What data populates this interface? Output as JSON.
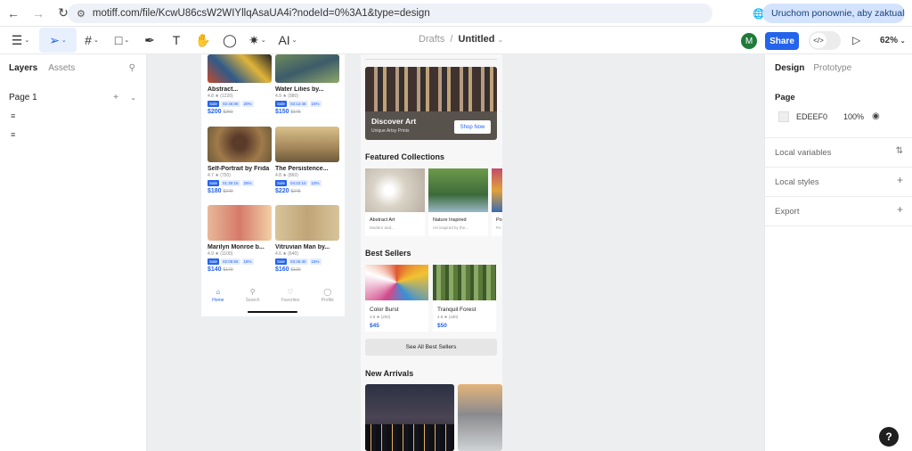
{
  "browser": {
    "url": "motiff.com/file/KcwU86csW2WIYllqAsaUA4i?nodeId=0%3A1&type=design",
    "profile_initial": "M",
    "restart_label": "Uruchom ponownie, aby zaktualizować"
  },
  "toolbar": {
    "ai_label": "AI",
    "breadcrumb_folder": "Drafts",
    "breadcrumb_sep": "/",
    "file_name": "Untitled",
    "user_initial": "M",
    "share_label": "Share",
    "zoom": "62%"
  },
  "left_panel": {
    "tab_layers": "Layers",
    "tab_assets": "Assets",
    "page_name": "Page 1"
  },
  "frame1": {
    "products": [
      {
        "title": "Abstract...",
        "rating": "4.8 ★ (1220)",
        "sale": "Sale",
        "timer": "02:46:06",
        "off": "20%",
        "price": "$200",
        "old": "$250",
        "color": "#b8503a"
      },
      {
        "title": "Water Lilies by...",
        "rating": "4.9 ★ (980)",
        "sale": "Sale",
        "timer": "03:12:46",
        "off": "15%",
        "price": "$150",
        "old": "$175",
        "color": "#4f6e4a"
      },
      {
        "title": "Self-Portrait by Frida",
        "rating": "4.7 ★ (750)",
        "sale": "Sale",
        "timer": "01:30:15",
        "off": "25%",
        "price": "$180",
        "old": "$240",
        "color": "#8a6a45"
      },
      {
        "title": "The Persistence...",
        "rating": "4.8 ★ (860)",
        "sale": "Sale",
        "timer": "04:22:10",
        "off": "10%",
        "price": "$220",
        "old": "$245",
        "color": "#b79a6a"
      },
      {
        "title": "Marilyn Monroe b...",
        "rating": "4.9 ★ (1100)",
        "sale": "Sale",
        "timer": "02:05:55",
        "off": "18%",
        "price": "$140",
        "old": "$170",
        "color": "#d9a088"
      },
      {
        "title": "Vitruvian Man by...",
        "rating": "4.6 ★ (640)",
        "sale": "Sale",
        "timer": "03:45:30",
        "off": "15%",
        "price": "$160",
        "old": "$190",
        "color": "#c9b28b"
      }
    ],
    "tabs": [
      "Home",
      "Search",
      "Favorites",
      "Profile"
    ]
  },
  "frame2": {
    "hero_title": "Discover Art",
    "hero_sub": "Unique Artsy Prints",
    "hero_btn": "Shop Now",
    "featured_title": "Featured Collections",
    "collections": [
      {
        "title": "Abstract Art",
        "desc": "Modern and...",
        "color": "#e3ddd4"
      },
      {
        "title": "Nature Inspired",
        "desc": "Art inspired by the...",
        "color": "#5f8a48"
      },
      {
        "title": "Po",
        "desc": "Po",
        "color": "#b2486a"
      }
    ],
    "bestsellers_title": "Best Sellers",
    "bestsellers": [
      {
        "title": "Color Burst",
        "rating": "4.9 ★ (200)",
        "price": "$45",
        "color": "#d7563b"
      },
      {
        "title": "Tranquil Forest",
        "rating": "4.8 ★ (180)",
        "price": "$50",
        "color": "#5d7a42"
      }
    ],
    "see_all": "See All Best Sellers",
    "new_arrivals_title": "New Arrivals"
  },
  "right_panel": {
    "tab_design": "Design",
    "tab_prototype": "Prototype",
    "page_label": "Page",
    "bg_hex": "EDEEF0",
    "bg_opacity": "100%",
    "local_variables": "Local variables",
    "local_styles": "Local styles",
    "export": "Export"
  },
  "help": "?"
}
